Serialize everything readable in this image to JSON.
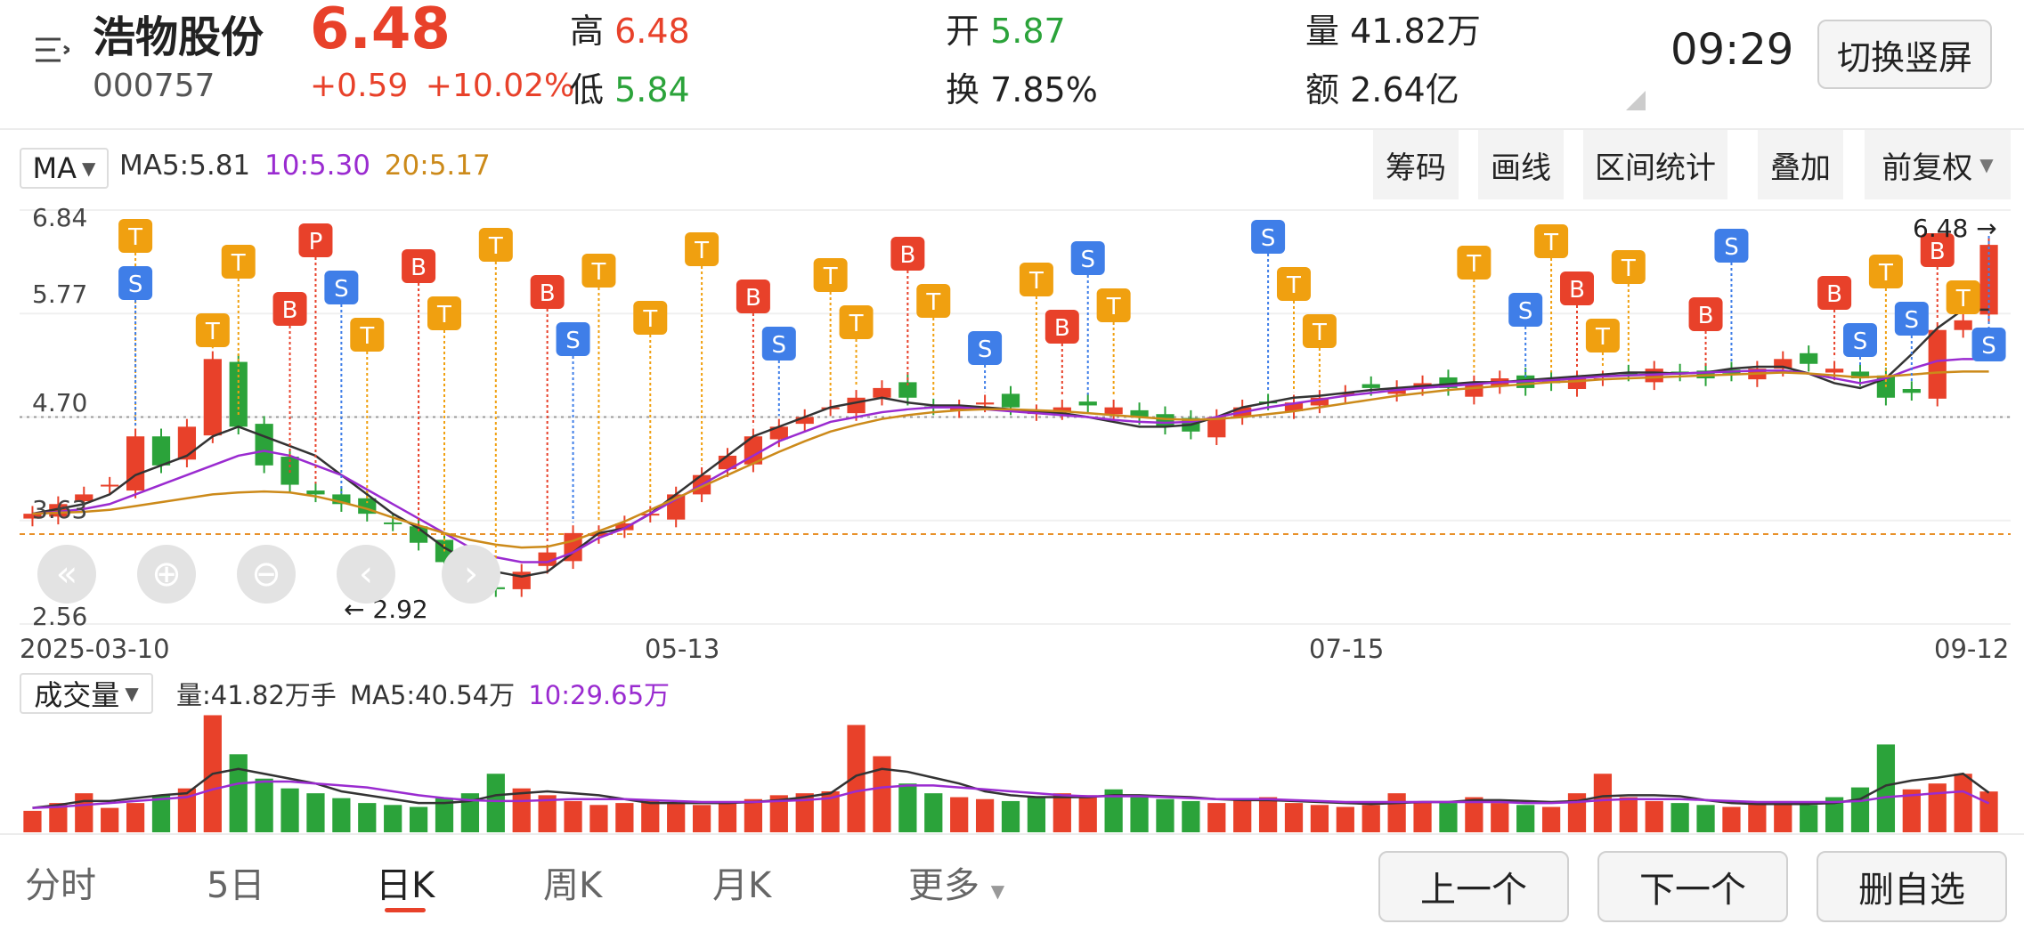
{
  "header": {
    "stock_name": "浩物股份",
    "stock_code": "000757",
    "price": "6.48",
    "change": "+0.59",
    "change_pct": "+10.02%",
    "high_label": "高",
    "high_value": "6.48",
    "low_label": "低",
    "low_value": "5.84",
    "open_label": "开",
    "open_value": "5.87",
    "turnover_label": "换",
    "turnover_value": "7.85%",
    "volume_label": "量",
    "volume_value": "41.82万",
    "amount_label": "额",
    "amount_value": "2.64亿",
    "time": "09:29",
    "portrait_button": "切换竖屏"
  },
  "toolbar": {
    "ma_select": "MA",
    "ma_legend": {
      "ma5": "MA5:5.81",
      "ma10": "10:5.30",
      "ma20": "20:5.17"
    },
    "tools": [
      "筹码",
      "画线",
      "区间统计",
      "叠加",
      "前复权"
    ]
  },
  "price_axis": [
    "6.84",
    "5.77",
    "4.70",
    "3.63",
    "2.56"
  ],
  "date_axis": [
    "2025-03-10",
    "05-13",
    "07-15",
    "09-12"
  ],
  "annotations": {
    "high_marker": "6.48",
    "low_marker": "2.92"
  },
  "volume": {
    "select": "成交量",
    "legend_vol": "量:41.82万手",
    "legend_ma5": "MA5:40.54万",
    "legend_ma10": "10:29.65万"
  },
  "nav_tabs": [
    "分时",
    "5日",
    "日K",
    "周K",
    "月K",
    "更多"
  ],
  "active_tab": "日K",
  "bottom_buttons": [
    "上一个",
    "下一个",
    "删自选"
  ],
  "colors": {
    "up": "#e8412a",
    "down": "#2ba33a",
    "ma5": "#333333",
    "ma10": "#9a2bd0",
    "ma20": "#cc8a1a",
    "signal_t": "#f0a010",
    "signal_b": "#e8412a",
    "signal_s": "#3f7ee8"
  },
  "chart_data": {
    "type": "candlestick",
    "title": "",
    "ylim": [
      2.56,
      6.84
    ],
    "x_ticks": [
      "2025-03-10",
      "05-13",
      "07-15",
      "09-12"
    ],
    "closes": [
      3.7,
      3.8,
      3.9,
      4.0,
      4.5,
      4.2,
      4.6,
      5.3,
      4.6,
      4.2,
      4.0,
      3.9,
      3.8,
      3.7,
      3.6,
      3.4,
      3.2,
      3.0,
      2.92,
      3.1,
      3.3,
      3.5,
      3.5,
      3.6,
      3.7,
      3.9,
      4.1,
      4.3,
      4.5,
      4.6,
      4.7,
      4.8,
      4.9,
      5.0,
      4.9,
      4.8,
      4.8,
      4.85,
      4.8,
      4.75,
      4.8,
      4.82,
      4.8,
      4.7,
      4.6,
      4.55,
      4.7,
      4.8,
      4.85,
      4.85,
      4.9,
      4.95,
      5.0,
      5.0,
      5.05,
      5.0,
      5.05,
      5.1,
      5.0,
      5.05,
      5.1,
      5.1,
      5.15,
      5.2,
      5.15,
      5.1,
      5.15,
      5.2,
      5.3,
      5.25,
      5.2,
      5.1,
      4.9,
      4.95,
      5.6,
      5.7,
      6.48
    ],
    "ma5": [
      3.7,
      3.75,
      3.8,
      3.9,
      4.1,
      4.2,
      4.3,
      4.5,
      4.6,
      4.5,
      4.4,
      4.3,
      4.1,
      3.9,
      3.7,
      3.55,
      3.35,
      3.2,
      3.1,
      3.05,
      3.1,
      3.3,
      3.5,
      3.55,
      3.7,
      3.9,
      4.1,
      4.3,
      4.5,
      4.6,
      4.7,
      4.8,
      4.85,
      4.9,
      4.85,
      4.82,
      4.82,
      4.8,
      4.78,
      4.76,
      4.74,
      4.7,
      4.65,
      4.6,
      4.6,
      4.62,
      4.7,
      4.8,
      4.85,
      4.9,
      4.92,
      4.95,
      4.98,
      5.0,
      5.02,
      5.04,
      5.06,
      5.06,
      5.08,
      5.1,
      5.12,
      5.14,
      5.16,
      5.16,
      5.15,
      5.16,
      5.2,
      5.22,
      5.22,
      5.15,
      5.05,
      5.0,
      5.1,
      5.35,
      5.62,
      5.81,
      5.81
    ],
    "ma10": [
      3.7,
      3.72,
      3.75,
      3.8,
      3.9,
      4.0,
      4.1,
      4.2,
      4.3,
      4.35,
      4.3,
      4.2,
      4.1,
      3.95,
      3.8,
      3.65,
      3.5,
      3.35,
      3.25,
      3.2,
      3.2,
      3.3,
      3.45,
      3.55,
      3.7,
      3.85,
      4.0,
      4.15,
      4.3,
      4.45,
      4.55,
      4.65,
      4.7,
      4.75,
      4.78,
      4.8,
      4.8,
      4.78,
      4.76,
      4.74,
      4.72,
      4.7,
      4.67,
      4.65,
      4.64,
      4.65,
      4.7,
      4.75,
      4.8,
      4.84,
      4.88,
      4.92,
      4.95,
      4.98,
      5.0,
      5.02,
      5.04,
      5.06,
      5.07,
      5.08,
      5.1,
      5.12,
      5.13,
      5.14,
      5.15,
      5.16,
      5.17,
      5.18,
      5.18,
      5.15,
      5.1,
      5.05,
      5.1,
      5.2,
      5.28,
      5.3,
      5.3
    ],
    "ma20": [
      3.7,
      3.71,
      3.72,
      3.74,
      3.78,
      3.82,
      3.86,
      3.9,
      3.92,
      3.93,
      3.92,
      3.88,
      3.82,
      3.75,
      3.66,
      3.58,
      3.5,
      3.43,
      3.38,
      3.35,
      3.36,
      3.42,
      3.52,
      3.62,
      3.74,
      3.86,
      3.98,
      4.1,
      4.22,
      4.34,
      4.45,
      4.55,
      4.62,
      4.68,
      4.72,
      4.75,
      4.77,
      4.78,
      4.78,
      4.77,
      4.76,
      4.74,
      4.72,
      4.7,
      4.68,
      4.67,
      4.68,
      4.7,
      4.73,
      4.76,
      4.8,
      4.84,
      4.88,
      4.92,
      4.95,
      4.98,
      5.0,
      5.02,
      5.04,
      5.06,
      5.07,
      5.09,
      5.1,
      5.11,
      5.12,
      5.13,
      5.14,
      5.15,
      5.16,
      5.15,
      5.13,
      5.11,
      5.12,
      5.14,
      5.16,
      5.17,
      5.17
    ],
    "volumes": [
      22,
      30,
      40,
      25,
      30,
      38,
      45,
      120,
      80,
      55,
      45,
      40,
      35,
      30,
      28,
      26,
      35,
      40,
      60,
      45,
      38,
      32,
      28,
      30,
      32,
      30,
      28,
      30,
      34,
      38,
      40,
      42,
      110,
      78,
      50,
      40,
      36,
      34,
      32,
      36,
      40,
      38,
      44,
      36,
      34,
      32,
      30,
      34,
      36,
      30,
      28,
      26,
      28,
      40,
      32,
      30,
      36,
      30,
      28,
      26,
      40,
      60,
      36,
      32,
      30,
      28,
      26,
      30,
      32,
      28,
      36,
      46,
      90,
      44,
      50,
      60,
      41.82
    ],
    "volume_ma5": [
      25,
      28,
      32,
      32,
      35,
      38,
      40,
      60,
      65,
      60,
      55,
      50,
      42,
      38,
      34,
      30,
      30,
      32,
      38,
      40,
      42,
      40,
      38,
      34,
      30,
      30,
      30,
      30,
      31,
      33,
      36,
      40,
      58,
      65,
      62,
      56,
      50,
      42,
      38,
      36,
      36,
      36,
      38,
      38,
      37,
      36,
      34,
      33,
      33,
      32,
      31,
      30,
      29,
      30,
      31,
      31,
      33,
      33,
      32,
      31,
      32,
      37,
      38,
      38,
      37,
      33,
      30,
      29,
      29,
      29,
      30,
      34,
      48,
      53,
      56,
      60,
      40.54
    ],
    "volume_ma10": [
      25,
      26,
      28,
      30,
      32,
      34,
      36,
      44,
      50,
      52,
      52,
      50,
      48,
      46,
      42,
      38,
      35,
      33,
      32,
      32,
      33,
      34,
      34,
      34,
      33,
      32,
      31,
      31,
      31,
      32,
      33,
      35,
      42,
      46,
      48,
      48,
      46,
      44,
      42,
      40,
      38,
      37,
      37,
      37,
      36,
      35,
      34,
      34,
      34,
      33,
      32,
      31,
      31,
      31,
      31,
      31,
      31,
      31,
      30,
      30,
      31,
      33,
      34,
      34,
      34,
      33,
      32,
      31,
      31,
      31,
      31,
      32,
      36,
      38,
      40,
      42,
      29.65
    ]
  }
}
